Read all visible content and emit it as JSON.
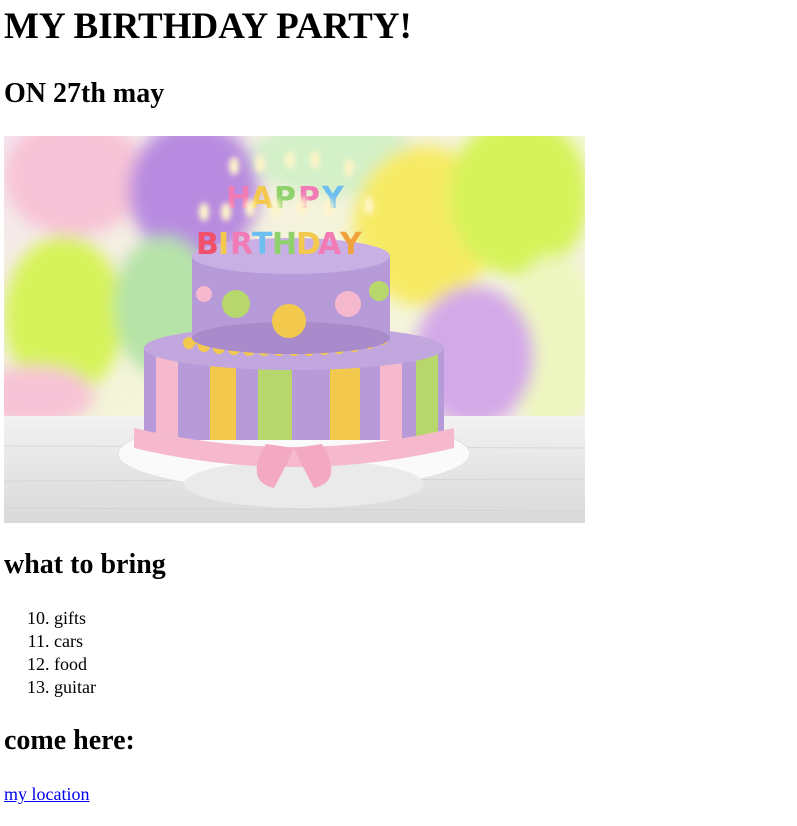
{
  "header": {
    "title": "MY BIRTHDAY PARTY!",
    "date_line": "ON 27th may"
  },
  "image": {
    "subject": "birthday cake with HAPPY BIRTHDAY candles and balloons",
    "candle_text_top": "HAPPY",
    "candle_text_bottom": "BIRTHDAY",
    "colors": {
      "cake_purple": "#b79ad8",
      "stripe_yellow": "#f2c94c",
      "stripe_green": "#b7d66b",
      "ribbon_pink": "#f5b8cc",
      "balloon_purple": "#b88be0",
      "balloon_lime": "#d7f35a",
      "balloon_pink": "#f7c3d6",
      "balloon_yellow": "#f7ea63"
    }
  },
  "bring": {
    "heading": "what to bring",
    "start": 10,
    "items": [
      "gifts",
      "cars",
      "food",
      "guitar"
    ]
  },
  "location": {
    "heading": "come here:",
    "link_text": "my location"
  }
}
